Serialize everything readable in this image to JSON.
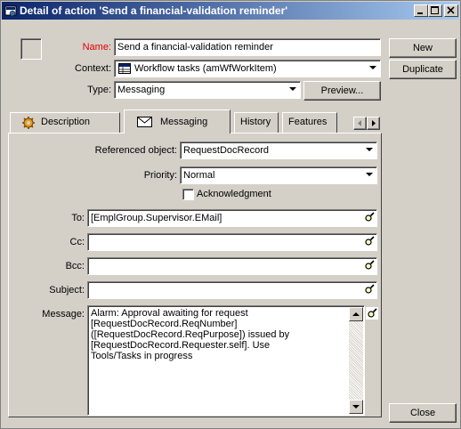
{
  "window": {
    "title": "Detail of action 'Send a financial-validation reminder'"
  },
  "header": {
    "name_label": "Name:",
    "name_value": "Send a financial-validation reminder",
    "context_label": "Context:",
    "context_value": "Workflow tasks (amWfWorkItem)",
    "type_label": "Type:",
    "type_value": "Messaging",
    "preview_button": "Preview..."
  },
  "side_buttons": {
    "new": "New",
    "duplicate": "Duplicate",
    "close": "Close"
  },
  "tabs": [
    {
      "label": "Description",
      "icon": "gear-icon"
    },
    {
      "label": "Messaging",
      "icon": "envelope-icon",
      "active": true
    },
    {
      "label": "History"
    },
    {
      "label": "Features"
    }
  ],
  "messaging": {
    "referenced_object_label": "Referenced object:",
    "referenced_object_value": "RequestDocRecord",
    "priority_label": "Priority:",
    "priority_value": "Normal",
    "acknowledgment_label": "Acknowledgment",
    "to_label": "To:",
    "to_value": "[EmplGroup.Supervisor.EMail]",
    "cc_label": "Cc:",
    "cc_value": "",
    "bcc_label": "Bcc:",
    "bcc_value": "",
    "subject_label": "Subject:",
    "subject_value": "",
    "message_label": "Message:",
    "message_lines": [
      "Alarm: Approval awaiting for request",
      "[RequestDocRecord.ReqNumber]",
      "([RequestDocRecord.ReqPurpose]) issued by",
      "[RequestDocRecord.Requester.self]. Use",
      "Tools/Tasks in progress"
    ]
  },
  "colors": {
    "title_start": "#0a246a",
    "title_end": "#a6caf0",
    "required_label": "#e00000",
    "face": "#d4d0c8"
  }
}
